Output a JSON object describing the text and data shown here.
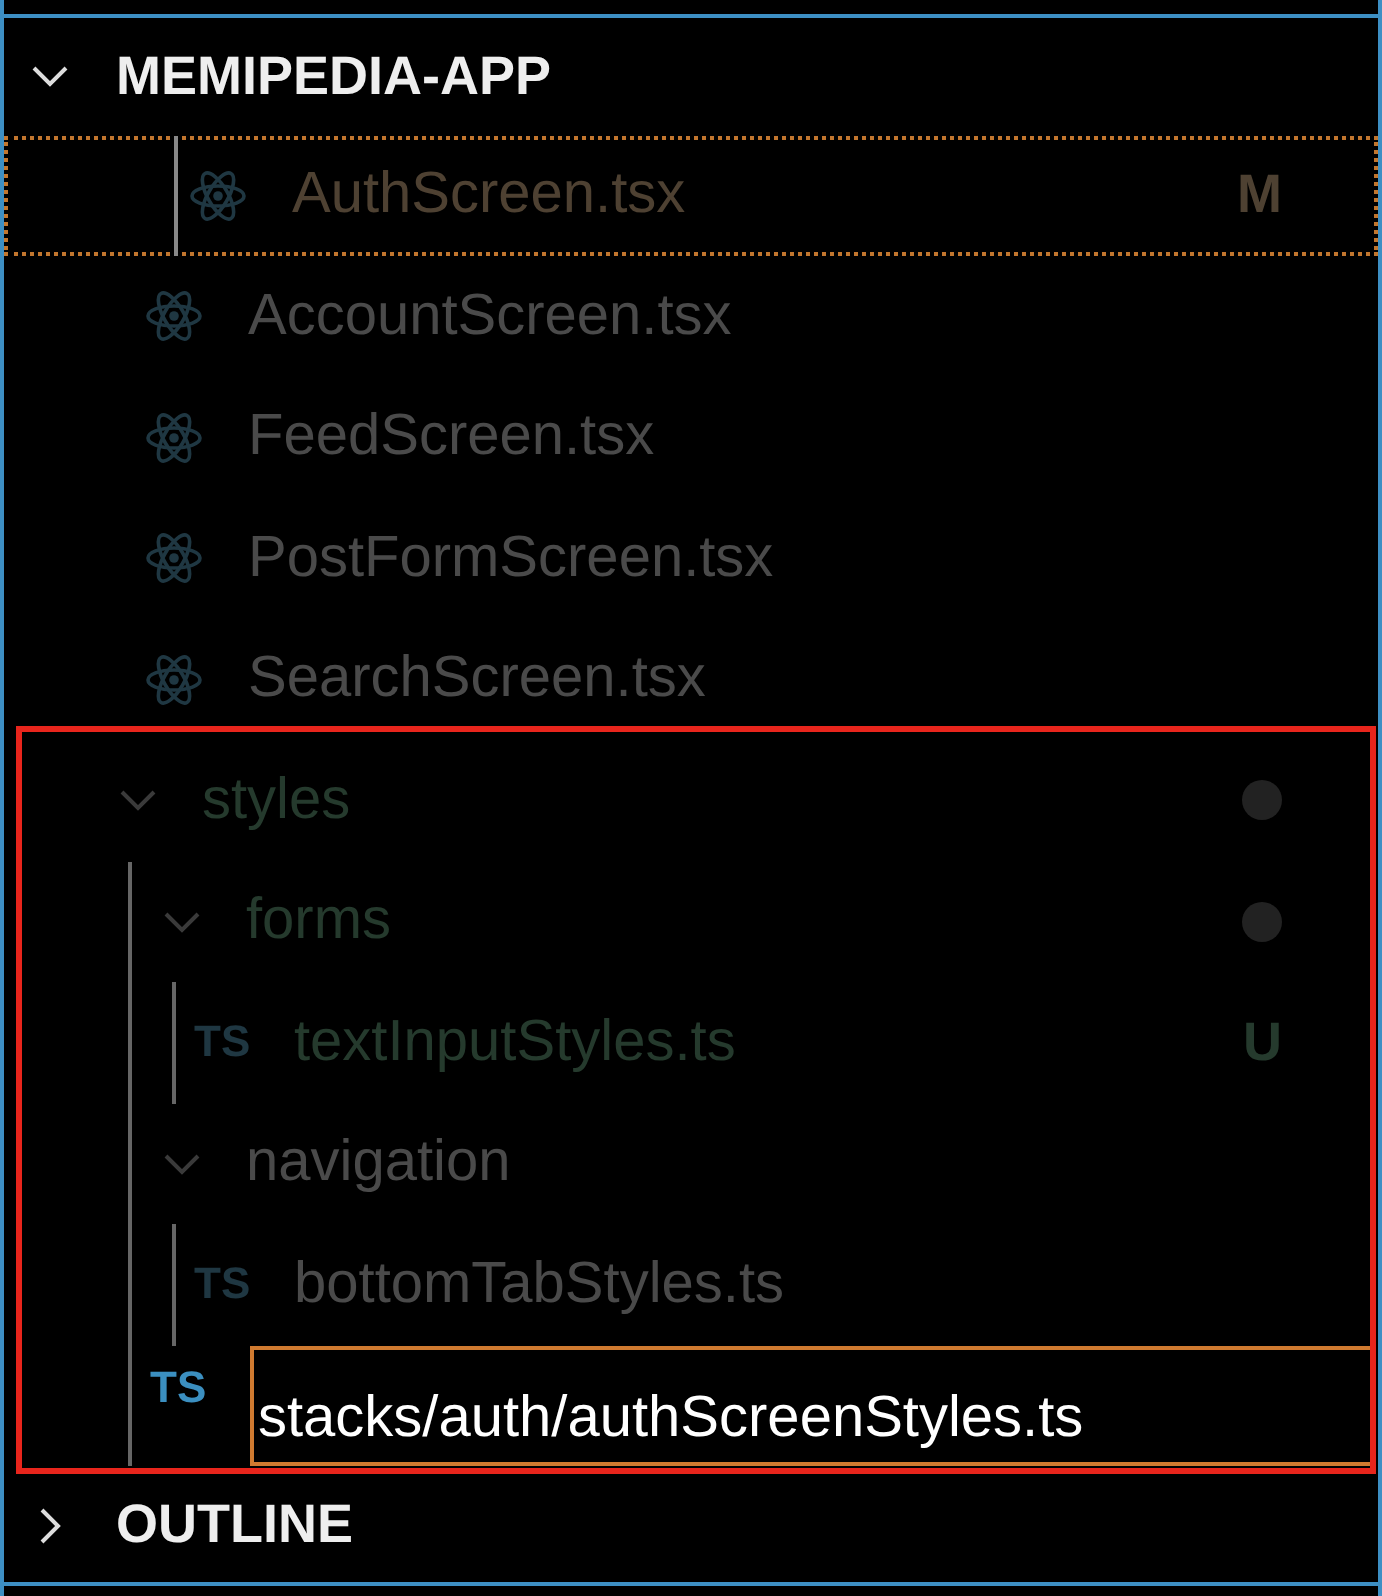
{
  "explorer": {
    "title": "MEMIPEDIA-APP",
    "expanded": true,
    "files": [
      {
        "kind": "react",
        "name": "AuthScreen.tsx",
        "color": "#4e4132",
        "badge": "M",
        "focused": true
      },
      {
        "kind": "react",
        "name": "AccountScreen.tsx",
        "color": "#4a4a4a",
        "focused": false
      },
      {
        "kind": "react",
        "name": "FeedScreen.tsx",
        "color": "#4a4a4a",
        "focused": false
      },
      {
        "kind": "react",
        "name": "PostFormScreen.tsx",
        "color": "#4a4a4a",
        "focused": false
      },
      {
        "kind": "react",
        "name": "SearchScreen.tsx",
        "color": "#4a4a4a",
        "focused": false
      }
    ],
    "tree": [
      {
        "kind": "folder",
        "name": "styles",
        "color": "#253a2d",
        "dot": true,
        "expanded": true,
        "children": [
          {
            "kind": "folder",
            "name": "forms",
            "color": "#253a2d",
            "dot": true,
            "expanded": true,
            "children": [
              {
                "kind": "ts",
                "icon_text": "TS",
                "name": "textInputStyles.ts",
                "color": "#253a2d",
                "badge": "U"
              }
            ]
          },
          {
            "kind": "folder",
            "name": "navigation",
            "color": "#4a4a4a",
            "dot": false,
            "expanded": true,
            "children": [
              {
                "kind": "ts",
                "icon_text": "TS",
                "name": "bottomTabStyles.ts",
                "color": "#4a4a4a"
              }
            ]
          },
          {
            "kind": "input",
            "icon_text": "TS",
            "value": "stacks/auth/authScreenStyles.ts"
          }
        ]
      }
    ]
  },
  "outline": {
    "title": "OUTLINE",
    "expanded": false
  }
}
